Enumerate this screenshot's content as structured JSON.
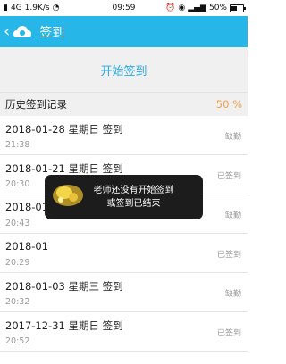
{
  "status_bar": {
    "network": "4G",
    "speed": "1.9K/s",
    "time": "09:59",
    "battery_percent_text": "50%",
    "battery_level": 0.5
  },
  "app_bar": {
    "title": "签到",
    "back_icon": "back-arrow-icon",
    "logo_icon": "cloud-logo-icon",
    "color": "#26b6e8"
  },
  "start_button": {
    "label": "开始签到"
  },
  "history": {
    "title": "历史签到记录",
    "percent": "50 %",
    "records": [
      {
        "date_line": "2018-01-28 星期日 签到",
        "time": "21:38",
        "status": "缺勤"
      },
      {
        "date_line": "2018-01-21 星期日 签到",
        "time": "20:30",
        "status": "已签到"
      },
      {
        "date_line": "2018-01",
        "time": "20:43",
        "status": "缺勤"
      },
      {
        "date_line": "2018-01",
        "time": "20:29",
        "status": "已签到"
      },
      {
        "date_line": "2018-01-03 星期三 签到",
        "time": "20:32",
        "status": "缺勤"
      },
      {
        "date_line": "2017-12-31 星期日 签到",
        "time": "20:52",
        "status": "已签到"
      }
    ]
  },
  "toast": {
    "line1": "老师还没有开始签到",
    "line2": "或签到已结束"
  }
}
